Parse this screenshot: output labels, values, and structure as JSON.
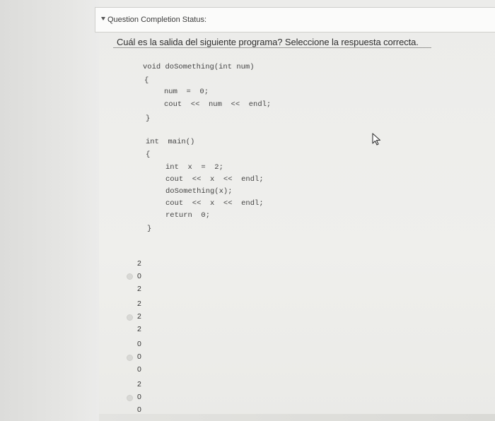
{
  "status": {
    "label": "Question Completion Status:"
  },
  "question": {
    "text": "Cuál es la salida del siguiente programa? Seleccione la respuesta correcta."
  },
  "code": {
    "lines": [
      "void doSomething(int num)",
      "{",
      "num  =  0;",
      "cout  <<  num  <<  endl;",
      "}",
      "int  main()",
      "{",
      "int  x  =  2;",
      "cout  <<  x  <<  endl;",
      "doSomething(x);",
      "cout  <<  x  <<  endl;",
      "return  0;",
      "}"
    ]
  },
  "options": [
    {
      "lines": [
        "2",
        "0",
        "2"
      ]
    },
    {
      "lines": [
        "2",
        "2",
        "2"
      ]
    },
    {
      "lines": [
        "0",
        "0",
        "0"
      ]
    },
    {
      "lines": [
        "2",
        "0",
        "0"
      ]
    }
  ],
  "icons": {
    "cursor": "mouse-pointer-icon",
    "collapse": "caret-down-icon"
  }
}
